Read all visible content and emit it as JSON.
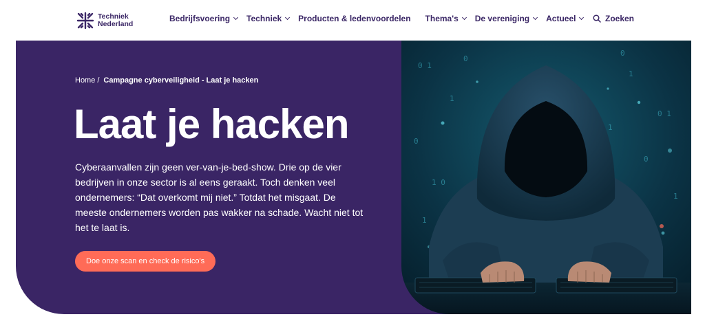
{
  "logo": {
    "line1": "Techniek",
    "line2": "Nederland"
  },
  "nav": {
    "items": [
      {
        "label": "Bedrijfsvoering",
        "has_dropdown": true
      },
      {
        "label": "Techniek",
        "has_dropdown": true
      },
      {
        "label": "Producten & ledenvoordelen",
        "has_dropdown": false
      },
      {
        "label": "Thema's",
        "has_dropdown": true
      },
      {
        "label": "De vereniging",
        "has_dropdown": true
      },
      {
        "label": "Actueel",
        "has_dropdown": true
      }
    ],
    "search_label": "Zoeken"
  },
  "breadcrumb": {
    "home": "Home",
    "separator": "/",
    "current": "Campagne cyberveiligheid - Laat je hacken"
  },
  "hero": {
    "title": "Laat je hacken",
    "text": "Cyberaanvallen zijn geen ver-van-je-bed-show. Drie op de vier bedrijven in onze sector is al eens geraakt. Toch denken veel ondernemers: “Dat overkomt mij niet.” Totdat het misgaat. De meeste ondernemers worden pas wakker na schade. Wacht niet tot het te laat is.",
    "cta_label": "Doe onze scan en check de risico's",
    "image_icon": "hooded-hacker-image"
  },
  "colors": {
    "brand_purple": "#3a2565",
    "text_purple": "#3b2766",
    "cta_orange": "#ff6b57",
    "image_teal": "#0d3a4c"
  }
}
